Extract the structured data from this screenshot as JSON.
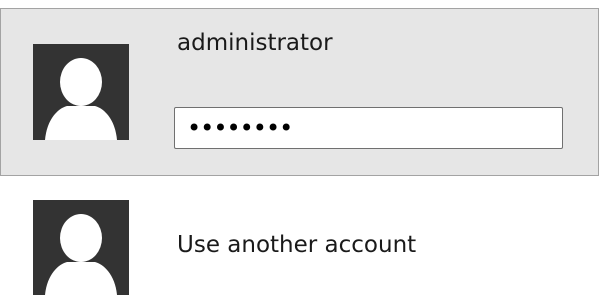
{
  "accounts": {
    "selected": {
      "username": "administrator",
      "password_masked": "••••••••",
      "avatar_icon": "user-silhouette-icon"
    },
    "other": {
      "label": "Use another account",
      "avatar_icon": "user-silhouette-icon"
    }
  },
  "colors": {
    "selected_background": "#e6e6e6",
    "avatar_background": "#333333",
    "avatar_figure": "#ffffff"
  }
}
